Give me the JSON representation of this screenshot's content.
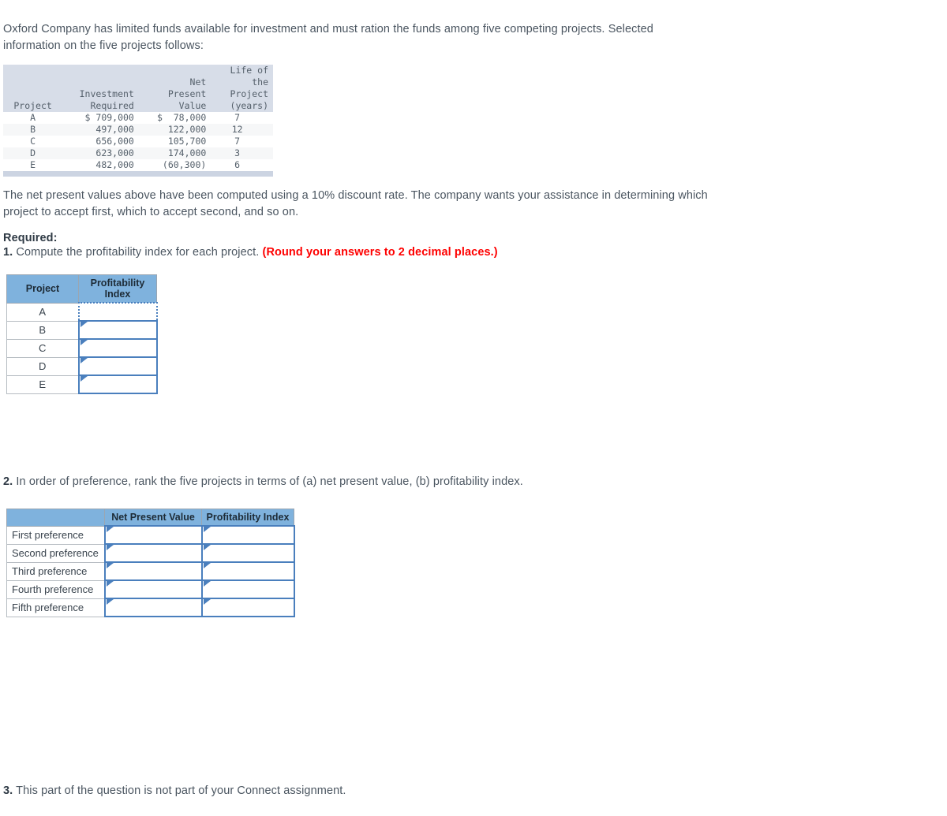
{
  "intro": {
    "paragraph": "Oxford Company has limited funds available for investment and must ration the funds among five competing projects. Selected information on the five projects follows:"
  },
  "given_table": {
    "headers": {
      "project": "Project",
      "investment_required": "Investment\nRequired",
      "net_present_value": "Net\nPresent\nValue",
      "life_of_project": "Life of the\nProject\n(years)"
    },
    "rows": [
      {
        "project": "A",
        "investment_required": "$ 709,000",
        "net_present_value": "$  78,000",
        "life_years": "7"
      },
      {
        "project": "B",
        "investment_required": "497,000",
        "net_present_value": "122,000",
        "life_years": "12"
      },
      {
        "project": "C",
        "investment_required": "656,000",
        "net_present_value": "105,700",
        "life_years": "7"
      },
      {
        "project": "D",
        "investment_required": "623,000",
        "net_present_value": "174,000",
        "life_years": "3"
      },
      {
        "project": "E",
        "investment_required": "482,000",
        "net_present_value": "(60,300)",
        "life_years": "6"
      }
    ]
  },
  "discount_note": {
    "paragraph": "The net present values above have been computed using a 10% discount rate. The company wants your assistance in determining which project to accept first, which to accept second, and so on."
  },
  "required": {
    "heading": "Required:",
    "q1_number": "1.",
    "q1_text": " Compute the profitability index for each project. ",
    "q1_round_note": "(Round your answers to 2 decimal places.)"
  },
  "q1_table": {
    "headers": {
      "project": "Project",
      "profitability_index": "Profitability Index"
    },
    "rows": [
      {
        "project": "A",
        "value": ""
      },
      {
        "project": "B",
        "value": ""
      },
      {
        "project": "C",
        "value": ""
      },
      {
        "project": "D",
        "value": ""
      },
      {
        "project": "E",
        "value": ""
      }
    ]
  },
  "q2": {
    "number": "2.",
    "text": " In order of preference, rank the five projects in terms of (a) net present value, (b) profitability index."
  },
  "q2_table": {
    "headers": {
      "blank": "",
      "net_present_value": "Net Present Value",
      "profitability_index": "Profitability Index"
    },
    "rows": [
      {
        "label": "First preference",
        "npv": "",
        "pi": ""
      },
      {
        "label": "Second preference",
        "npv": "",
        "pi": ""
      },
      {
        "label": "Third preference",
        "npv": "",
        "pi": ""
      },
      {
        "label": "Fourth preference",
        "npv": "",
        "pi": ""
      },
      {
        "label": "Fifth preference",
        "npv": "",
        "pi": ""
      }
    ]
  },
  "q3": {
    "number": "3.",
    "text": " This part of the question is not part of your Connect assignment."
  },
  "colors": {
    "header_blue": "#7fb2dd",
    "cell_border_blue": "#4a7fbd",
    "given_header_bg": "#d7dde8",
    "given_footer_bg": "#ccd4e2",
    "red_note": "#fe0000",
    "body_text": "#4a5560"
  }
}
